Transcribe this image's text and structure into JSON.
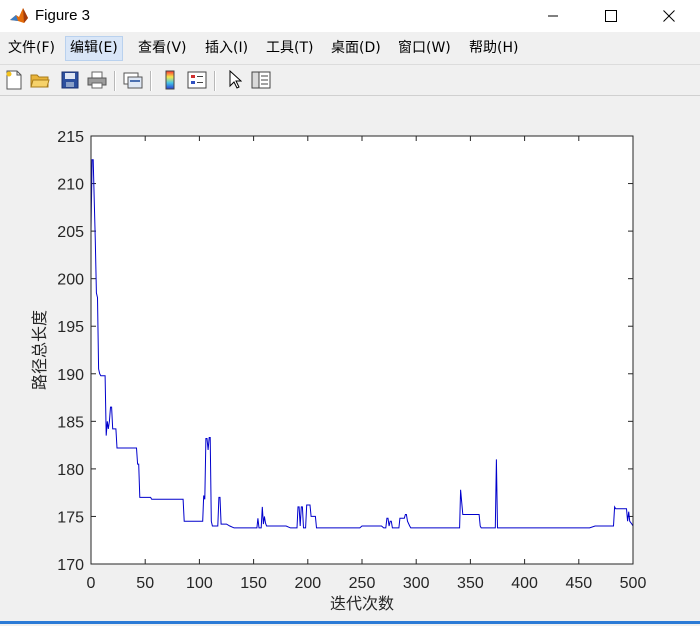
{
  "window": {
    "title": "Figure 3",
    "controls": [
      "minimize",
      "maximize",
      "close"
    ]
  },
  "menu": {
    "items": [
      {
        "label": "文件(F)",
        "active": false
      },
      {
        "label": "编辑(E)",
        "active": true
      },
      {
        "label": "查看(V)",
        "active": false
      },
      {
        "label": "插入(I)",
        "active": false
      },
      {
        "label": "工具(T)",
        "active": false
      },
      {
        "label": "桌面(D)",
        "active": false
      },
      {
        "label": "窗口(W)",
        "active": false
      },
      {
        "label": "帮助(H)",
        "active": false
      }
    ]
  },
  "toolbar": {
    "buttons": [
      "new-figure-icon",
      "open-file-icon",
      "save-icon",
      "print-icon",
      "link-plot-icon",
      "colorbar-icon",
      "legend-icon",
      "pointer-icon",
      "property-editor-icon"
    ]
  },
  "colors": {
    "line": "#0000cc",
    "accent": "#2b7bd6"
  },
  "chart_data": {
    "type": "line",
    "xlabel": "迭代次数",
    "ylabel": "路径总长度",
    "xlim": [
      0,
      500
    ],
    "ylim": [
      170,
      215
    ],
    "xticks": [
      0,
      50,
      100,
      150,
      200,
      250,
      300,
      350,
      400,
      450,
      500
    ],
    "yticks": [
      170,
      175,
      180,
      185,
      190,
      195,
      200,
      205,
      210,
      215
    ],
    "grid": false,
    "series": [
      {
        "color": "#0000cc",
        "points": [
          [
            0,
            205.0
          ],
          [
            1,
            212.5
          ],
          [
            2,
            212.5
          ],
          [
            3,
            208.0
          ],
          [
            4,
            204.0
          ],
          [
            5,
            198.5
          ],
          [
            6,
            198.0
          ],
          [
            7,
            190.5
          ],
          [
            8,
            190.0
          ],
          [
            9,
            189.8
          ],
          [
            12,
            189.8
          ],
          [
            13,
            189.8
          ],
          [
            14,
            183.5
          ],
          [
            15,
            185.0
          ],
          [
            16,
            184.2
          ],
          [
            17,
            185.0
          ],
          [
            18,
            186.5
          ],
          [
            19,
            186.5
          ],
          [
            20,
            184.2
          ],
          [
            22,
            184.2
          ],
          [
            23,
            184.2
          ],
          [
            24,
            182.2
          ],
          [
            25,
            182.2
          ],
          [
            40,
            182.2
          ],
          [
            42,
            182.2
          ],
          [
            43,
            180.5
          ],
          [
            44,
            180.5
          ],
          [
            45,
            177.0
          ],
          [
            55,
            177.0
          ],
          [
            56,
            176.8
          ],
          [
            57,
            176.8
          ],
          [
            85,
            176.8
          ],
          [
            86,
            174.5
          ],
          [
            103,
            174.5
          ],
          [
            104,
            177.2
          ],
          [
            105,
            176.8
          ],
          [
            106,
            183.2
          ],
          [
            107,
            183.2
          ],
          [
            108,
            182.0
          ],
          [
            109,
            183.3
          ],
          [
            110,
            183.3
          ],
          [
            111,
            174.5
          ],
          [
            112,
            174.0
          ],
          [
            117,
            174.0
          ],
          [
            118,
            177.0
          ],
          [
            119,
            177.0
          ],
          [
            120,
            174.2
          ],
          [
            125,
            174.2
          ],
          [
            128,
            174.0
          ],
          [
            132,
            173.8
          ],
          [
            153,
            173.8
          ],
          [
            154,
            174.8
          ],
          [
            155,
            173.8
          ],
          [
            157,
            173.8
          ],
          [
            158,
            176.0
          ],
          [
            159,
            174.2
          ],
          [
            160,
            175.0
          ],
          [
            161,
            174.3
          ],
          [
            162,
            174.0
          ],
          [
            165,
            174.0
          ],
          [
            172,
            174.0
          ],
          [
            174,
            174.0
          ],
          [
            180,
            174.0
          ],
          [
            184,
            173.8
          ],
          [
            190,
            173.8
          ],
          [
            191,
            176.0
          ],
          [
            192,
            176.0
          ],
          [
            193,
            174.0
          ],
          [
            194,
            176.0
          ],
          [
            195,
            176.0
          ],
          [
            196,
            173.8
          ],
          [
            198,
            173.8
          ],
          [
            199,
            176.2
          ],
          [
            202,
            176.2
          ],
          [
            203,
            175.0
          ],
          [
            207,
            175.0
          ],
          [
            208,
            173.8
          ],
          [
            248,
            173.8
          ],
          [
            250,
            174.0
          ],
          [
            268,
            174.0
          ],
          [
            270,
            173.8
          ],
          [
            272,
            173.8
          ],
          [
            273,
            174.8
          ],
          [
            274,
            174.8
          ],
          [
            275,
            174.0
          ],
          [
            276,
            174.5
          ],
          [
            277,
            174.5
          ],
          [
            278,
            173.8
          ],
          [
            284,
            173.8
          ],
          [
            285,
            174.8
          ],
          [
            286,
            174.8
          ],
          [
            289,
            174.8
          ],
          [
            290,
            175.2
          ],
          [
            291,
            175.2
          ],
          [
            292,
            174.5
          ],
          [
            294,
            174.0
          ],
          [
            295,
            173.8
          ],
          [
            340,
            173.8
          ],
          [
            341,
            177.8
          ],
          [
            342,
            176.5
          ],
          [
            343,
            175.2
          ],
          [
            358,
            175.2
          ],
          [
            359,
            174.0
          ],
          [
            360,
            173.8
          ],
          [
            373,
            173.8
          ],
          [
            374,
            181.0
          ],
          [
            375,
            173.8
          ],
          [
            376,
            173.8
          ],
          [
            460,
            173.8
          ],
          [
            465,
            174.0
          ],
          [
            480,
            174.0
          ],
          [
            482,
            174.0
          ],
          [
            483,
            176.0
          ],
          [
            484,
            175.8
          ],
          [
            494,
            175.8
          ],
          [
            495,
            174.5
          ],
          [
            496,
            175.5
          ],
          [
            497,
            174.5
          ],
          [
            499,
            174.2
          ],
          [
            500,
            174.0
          ]
        ]
      }
    ]
  }
}
